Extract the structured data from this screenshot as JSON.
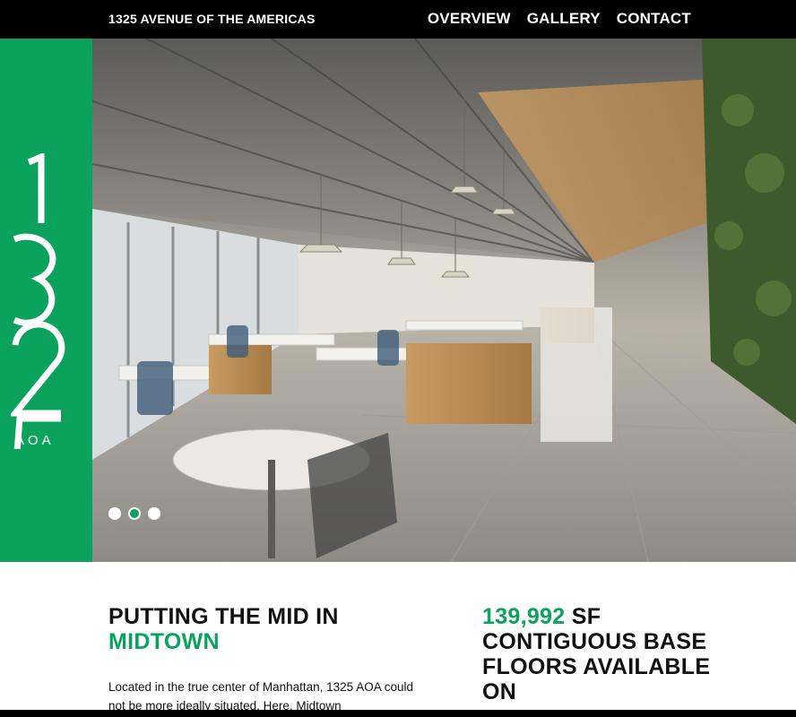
{
  "header": {
    "site_title": "1325 AVENUE OF THE AMERICAS",
    "nav": [
      {
        "label": "OVERVIEW"
      },
      {
        "label": "GALLERY"
      },
      {
        "label": "CONTACT"
      }
    ]
  },
  "brand": {
    "number": "1325",
    "sub": "AOA",
    "color": "#0aa25c"
  },
  "hero": {
    "image_description_icon": "office-interior-photo",
    "slides": [
      {
        "active": false
      },
      {
        "active": true
      },
      {
        "active": false
      }
    ]
  },
  "content": {
    "headline_line1": "PUTTING THE MID IN",
    "headline_line2": "MIDTOWN",
    "body": "Located in the true center of Manhattan, 1325 AOA could not be more ideally situated. Here, Midtown",
    "stat_number": "139,992",
    "stat_rest": " SF CONTIGUOUS BASE FLOORS AVAILABLE ON"
  }
}
